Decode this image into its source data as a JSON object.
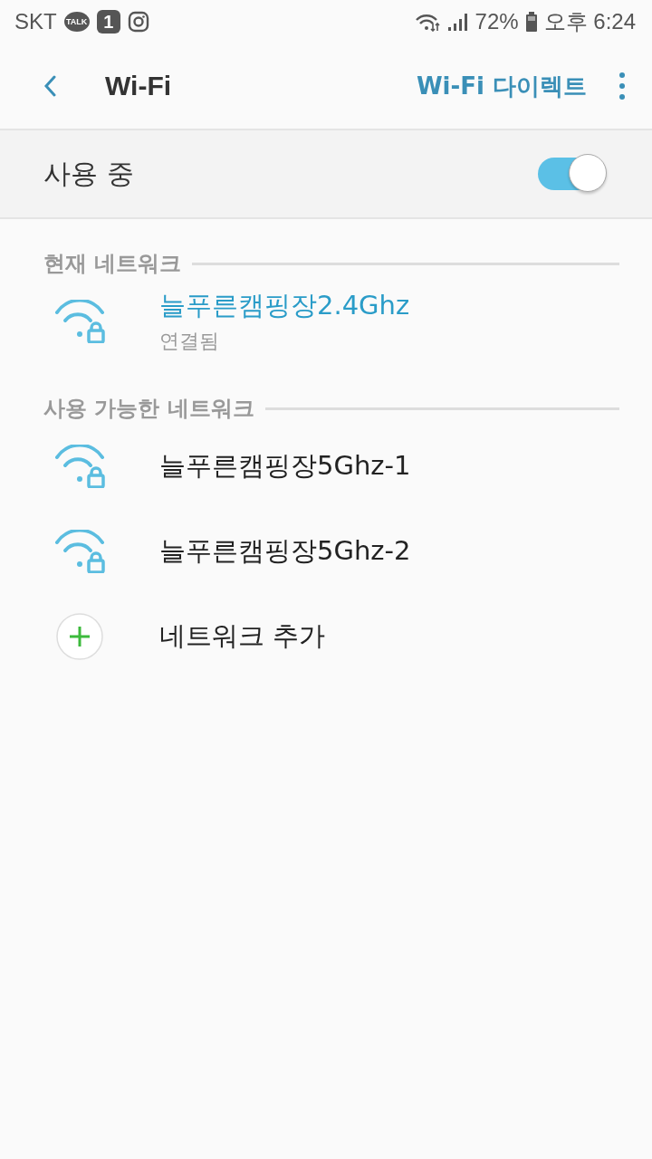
{
  "status_bar": {
    "carrier": "SKT",
    "notifications": [
      {
        "kind": "chat",
        "label": "TALK"
      },
      {
        "kind": "badge",
        "label": "1"
      },
      {
        "kind": "camera"
      }
    ],
    "battery_text": "72%",
    "time": "오후 6:24"
  },
  "header": {
    "title": "Wi-Fi",
    "action": "Wi-Fi 다이렉트"
  },
  "master_switch": {
    "label": "사용 중",
    "on": true
  },
  "sections": [
    {
      "title": "현재 네트워크",
      "items": [
        {
          "kind": "network",
          "name": "늘푸른캠핑장2.4Ghz",
          "status": "연결됨",
          "selected": true,
          "secured": true
        }
      ]
    },
    {
      "title": "사용 가능한 네트워크",
      "items": [
        {
          "kind": "network",
          "name": "늘푸른캠핑장5Ghz-1",
          "selected": false,
          "secured": true
        },
        {
          "kind": "network",
          "name": "늘푸른캠핑장5Ghz-2",
          "selected": false,
          "secured": true
        },
        {
          "kind": "add",
          "name": "네트워크 추가"
        }
      ]
    }
  ]
}
